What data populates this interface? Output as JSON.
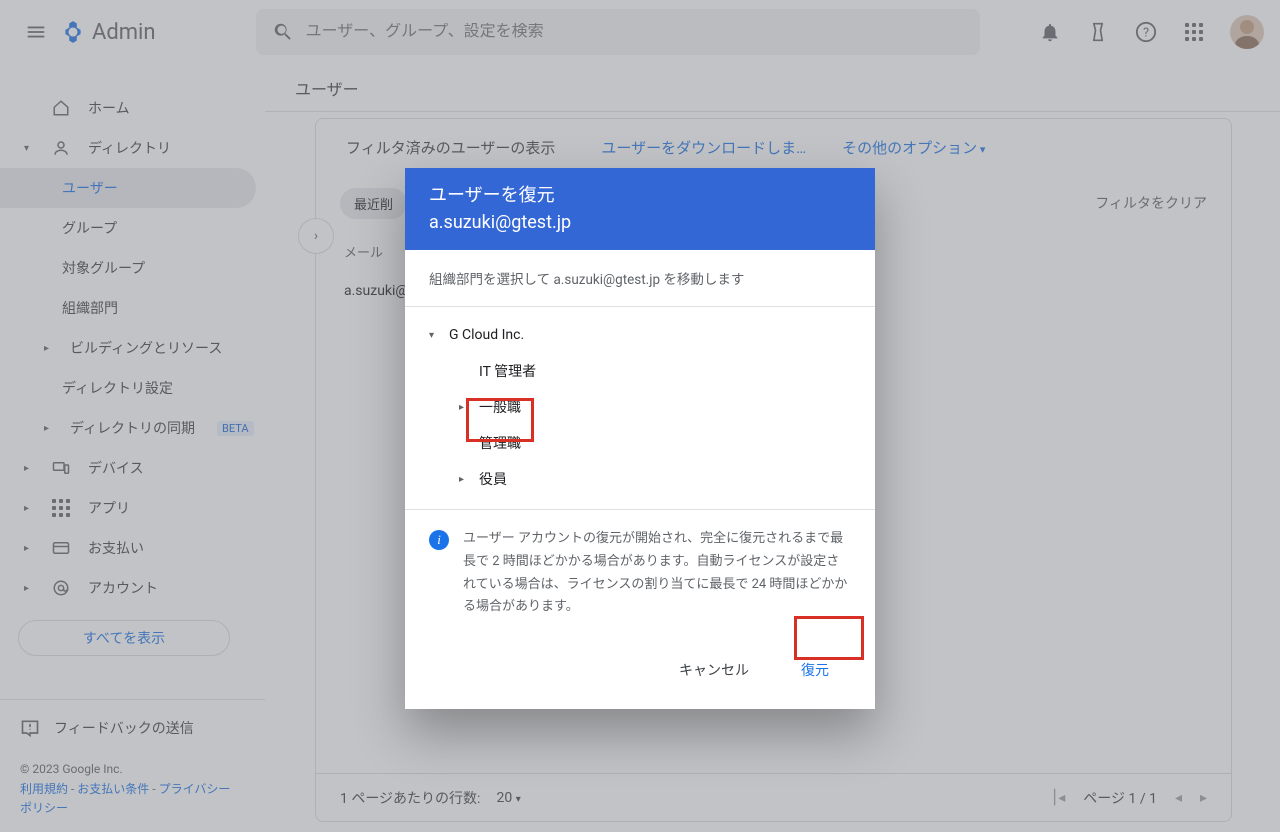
{
  "header": {
    "app_title": "Admin",
    "search_placeholder": "ユーザー、グループ、設定を検索"
  },
  "sidebar": {
    "home": "ホーム",
    "directory": "ディレクトリ",
    "users": "ユーザー",
    "groups": "グループ",
    "target_groups": "対象グループ",
    "org_units": "組織部門",
    "buildings": "ビルディングとリソース",
    "dir_settings": "ディレクトリ設定",
    "dir_sync": "ディレクトリの同期",
    "beta": "BETA",
    "devices": "デバイス",
    "apps": "アプリ",
    "billing": "お支払い",
    "account": "アカウント",
    "show_all": "すべてを表示",
    "feedback": "フィードバックの送信",
    "copyright": "© 2023 Google Inc.",
    "terms": "利用規約",
    "payment_terms": "お支払い条件",
    "privacy": "プライバシー ポリシー",
    "sep": " - "
  },
  "breadcrumb": "ユーザー",
  "panel": {
    "filtered_label": "フィルタ済みのユーザーの表示",
    "download": "ユーザーをダウンロードしま…",
    "more_options": "その他のオプション",
    "recent_chip": "最近削",
    "clear_filter": "フィルタをクリア",
    "col_mail": "メール",
    "row_mail": "a.suzuki@",
    "rows_label": "1 ページあたりの行数:",
    "rows_value": "20",
    "page_label": "ページ 1 / 1"
  },
  "dialog": {
    "title": "ユーザーを復元",
    "email": "a.suzuki@gtest.jp",
    "hint": "組織部門を選択して a.suzuki@gtest.jp を移動します",
    "tree": {
      "root": "G Cloud Inc.",
      "it_admin": "IT 管理者",
      "general": "一般職",
      "manager": "管理職",
      "exec": "役員"
    },
    "note": "ユーザー アカウントの復元が開始され、完全に復元されるまで最長で 2 時間ほどかかる場合があります。自動ライセンスが設定されている場合は、ライセンスの割り当てに最長で 24 時間ほどかかる場合があります。",
    "cancel": "キャンセル",
    "restore": "復元"
  }
}
